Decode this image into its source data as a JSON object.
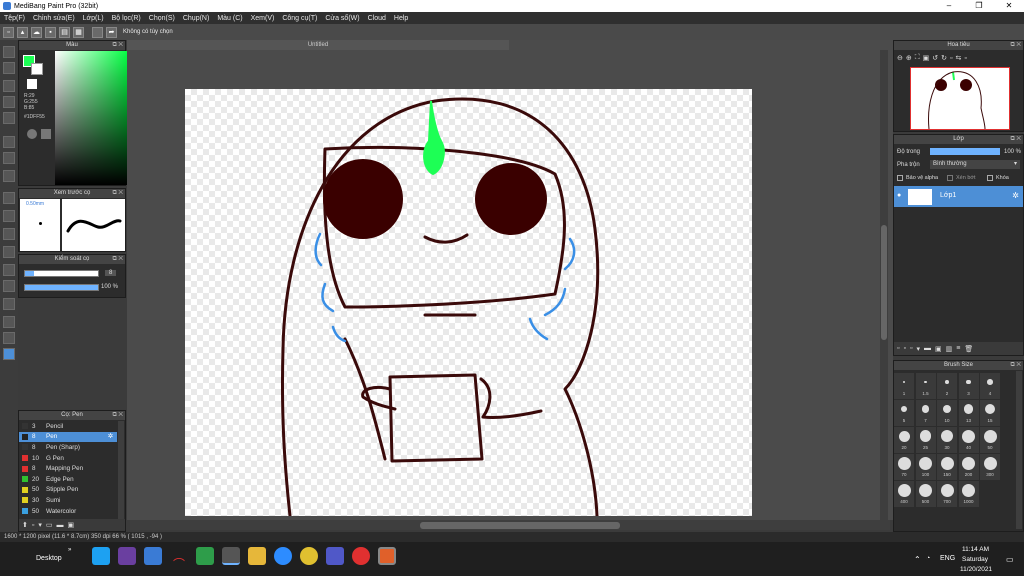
{
  "window": {
    "title": "MediBang Paint Pro (32bit)",
    "controls": [
      "–",
      "❐",
      "✕"
    ]
  },
  "menu": [
    "Tệp(F)",
    "Chỉnh sửa(E)",
    "Lớp(L)",
    "Bộ lọc(R)",
    "Chọn(S)",
    "Chụp(N)",
    "Màu (C)",
    "Xem(V)",
    "Công cụ(T)",
    "Cửa sổ(W)",
    "Cloud",
    "Help"
  ],
  "toolbar": {
    "selection_text": "Không có tùy chọn"
  },
  "color_panel": {
    "title": "Màu",
    "r": "R:29",
    "g": "G:255",
    "b": "B:85",
    "hex": "#1DFF55",
    "fg_color": "#1dff55",
    "bg_color": "#ffffff"
  },
  "document": {
    "tab_title": "Untitled"
  },
  "brush_preview": {
    "title": "Xem trước cọ",
    "size": "0.50mm"
  },
  "brush_control": {
    "title": "Kiểm soát cọ",
    "size_value": "8",
    "opacity_value": "100 %"
  },
  "brush_list": {
    "title": "Cọ: Pen",
    "items": [
      {
        "num": "3",
        "name": "Pencil",
        "color": "#333333",
        "selected": false
      },
      {
        "num": "8",
        "name": "Pen",
        "color": "#222222",
        "selected": true
      },
      {
        "num": "8",
        "name": "Pen (Sharp)",
        "color": "#333333",
        "selected": false
      },
      {
        "num": "10",
        "name": "G Pen",
        "color": "#e03030",
        "selected": false
      },
      {
        "num": "8",
        "name": "Mapping Pen",
        "color": "#e03030",
        "selected": false
      },
      {
        "num": "20",
        "name": "Edge Pen",
        "color": "#30c030",
        "selected": false
      },
      {
        "num": "50",
        "name": "Stipple Pen",
        "color": "#e0d020",
        "selected": false
      },
      {
        "num": "30",
        "name": "Sumi",
        "color": "#e0d020",
        "selected": false
      },
      {
        "num": "50",
        "name": "Watercolor",
        "color": "#3aa0e0",
        "selected": false
      }
    ]
  },
  "navigator": {
    "title": "Hoa tiêu"
  },
  "layer_panel": {
    "title": "Lớp",
    "opacity_label": "Độ trong",
    "opacity_value": "100 %",
    "blend_label": "Pha trộn",
    "blend_value": "Bình thường",
    "protect_alpha": "Bảo vệ alpha",
    "clipping": "Xén bớt",
    "lock": "Khóa",
    "layers": [
      {
        "name": "Lớp1"
      }
    ]
  },
  "brush_size": {
    "title": "Brush Size",
    "sizes": [
      "1",
      "1.5",
      "2",
      "3",
      "4",
      "5",
      "7",
      "10",
      "13",
      "15",
      "20",
      "25",
      "30",
      "40",
      "50",
      "70",
      "100",
      "150",
      "200",
      "300",
      "400",
      "500",
      "700",
      "1000"
    ]
  },
  "status": {
    "text": "1600 * 1200 pixel   (11.6 * 8.7cm)   350 dpi   66 %   ( 1015 , -94 )"
  },
  "taskbar": {
    "desktop_label": "Desktop",
    "language": "ENG",
    "time": "11:14 AM",
    "day": "Saturday",
    "date": "11/20/2021"
  }
}
